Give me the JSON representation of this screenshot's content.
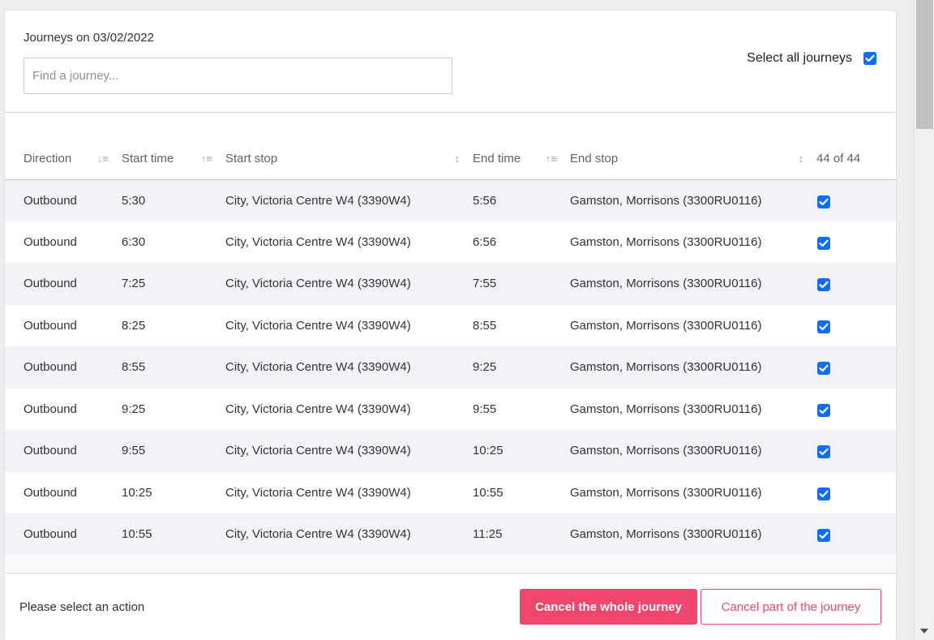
{
  "header": {
    "date_label": "Journeys on 03/02/2022",
    "search_placeholder": "Find a journey...",
    "select_all_label": "Select all journeys",
    "select_all_checked": true
  },
  "table": {
    "columns": {
      "direction": "Direction",
      "start_time": "Start time",
      "start_stop": "Start stop",
      "end_time": "End time",
      "end_stop": "End stop",
      "selected_count": "44 of 44"
    },
    "rows": [
      {
        "direction": "Outbound",
        "start_time": "5:30",
        "start_stop": "City, Victoria Centre W4 (3390W4)",
        "end_time": "5:56",
        "end_stop": "Gamston, Morrisons (3300RU0116)"
      },
      {
        "direction": "Outbound",
        "start_time": "6:30",
        "start_stop": "City, Victoria Centre W4 (3390W4)",
        "end_time": "6:56",
        "end_stop": "Gamston, Morrisons (3300RU0116)"
      },
      {
        "direction": "Outbound",
        "start_time": "7:25",
        "start_stop": "City, Victoria Centre W4 (3390W4)",
        "end_time": "7:55",
        "end_stop": "Gamston, Morrisons (3300RU0116)"
      },
      {
        "direction": "Outbound",
        "start_time": "8:25",
        "start_stop": "City, Victoria Centre W4 (3390W4)",
        "end_time": "8:55",
        "end_stop": "Gamston, Morrisons (3300RU0116)"
      },
      {
        "direction": "Outbound",
        "start_time": "8:55",
        "start_stop": "City, Victoria Centre W4 (3390W4)",
        "end_time": "9:25",
        "end_stop": "Gamston, Morrisons (3300RU0116)"
      },
      {
        "direction": "Outbound",
        "start_time": "9:25",
        "start_stop": "City, Victoria Centre W4 (3390W4)",
        "end_time": "9:55",
        "end_stop": "Gamston, Morrisons (3300RU0116)"
      },
      {
        "direction": "Outbound",
        "start_time": "9:55",
        "start_stop": "City, Victoria Centre W4 (3390W4)",
        "end_time": "10:25",
        "end_stop": "Gamston, Morrisons (3300RU0116)"
      },
      {
        "direction": "Outbound",
        "start_time": "10:25",
        "start_stop": "City, Victoria Centre W4 (3390W4)",
        "end_time": "10:55",
        "end_stop": "Gamston, Morrisons (3300RU0116)"
      },
      {
        "direction": "Outbound",
        "start_time": "10:55",
        "start_stop": "City, Victoria Centre W4 (3390W4)",
        "end_time": "11:25",
        "end_stop": "Gamston, Morrisons (3300RU0116)"
      }
    ]
  },
  "footer": {
    "message": "Please select an action",
    "cancel_whole_label": "Cancel the whole journey",
    "cancel_part_label": "Cancel part of the journey"
  },
  "colors": {
    "accent": "#f0466e",
    "checkbox": "#0d6efd",
    "stripe": "#f1f3f6"
  }
}
